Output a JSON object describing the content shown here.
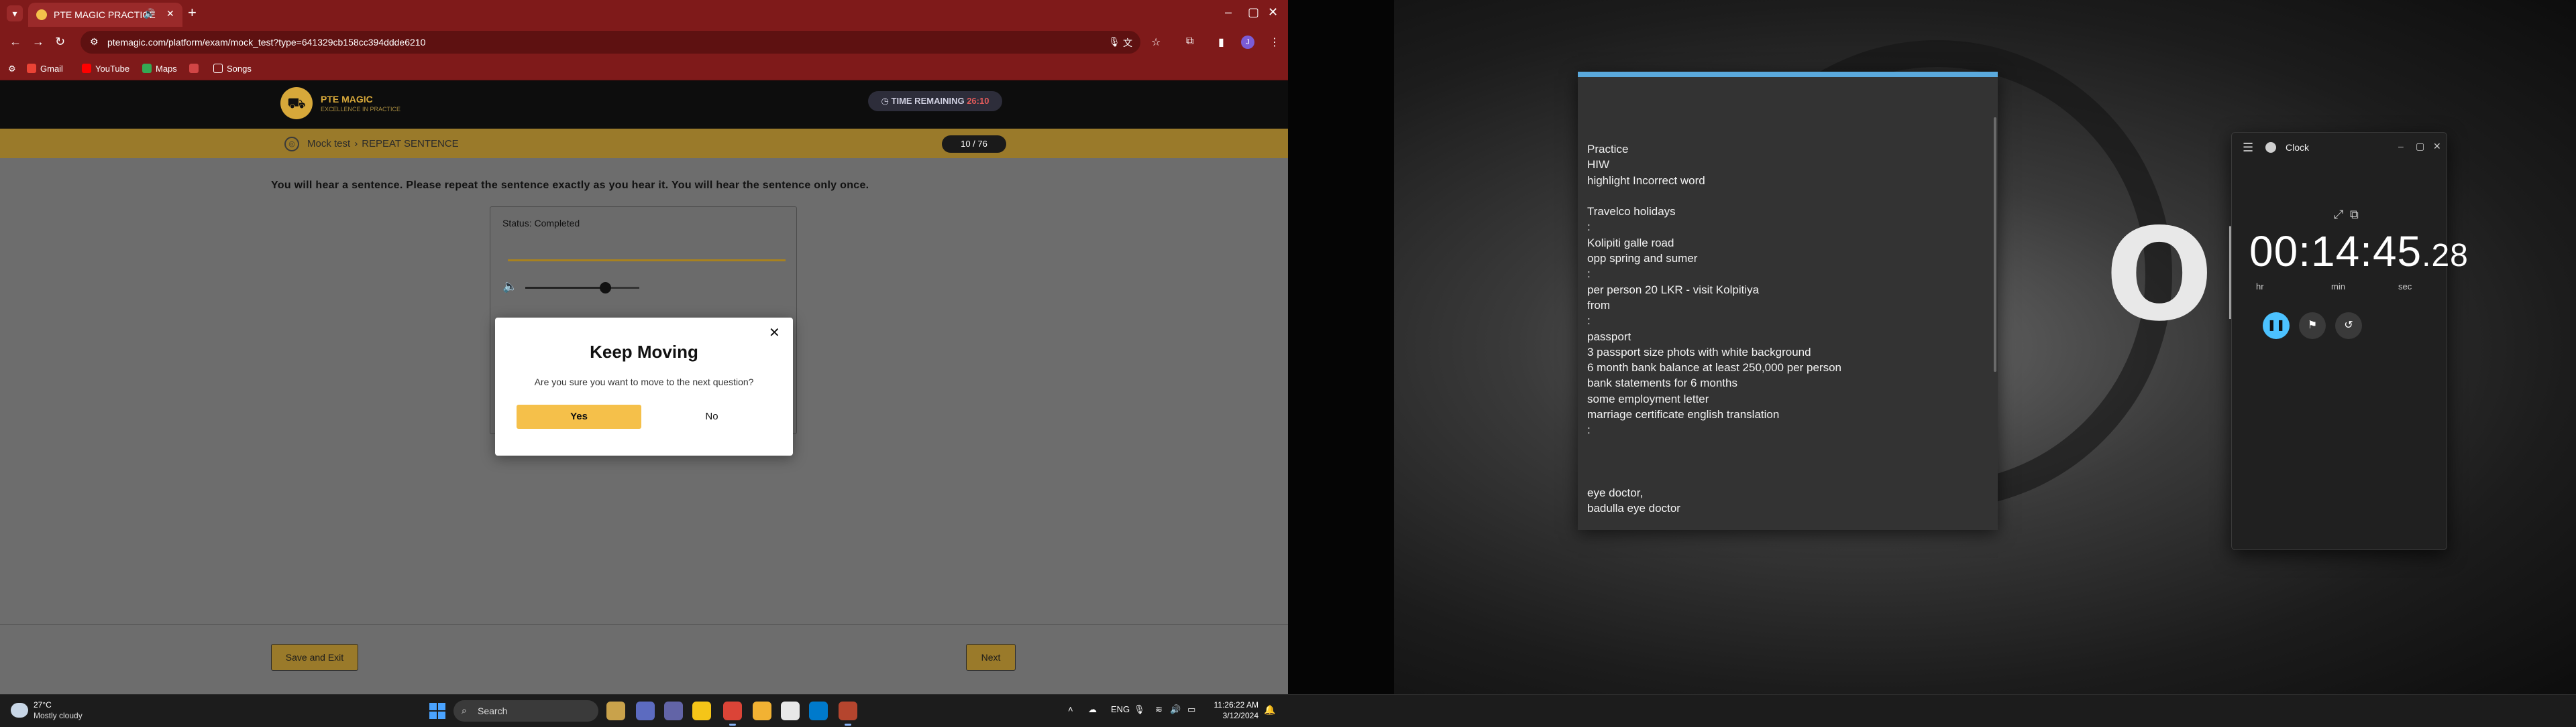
{
  "browser": {
    "tab_title": "PTE MAGIC PRACTICE",
    "url": "ptemagic.com/platform/exam/mock_test?type=641329cb158cc394ddde6210",
    "bookmarks": [
      "Gmail",
      "YouTube",
      "Maps",
      "Songs"
    ],
    "profile_initial": "J"
  },
  "site": {
    "logo_name": "PTE MAGIC",
    "logo_tagline": "EXCELLENCE IN PRACTICE",
    "timer_label": "TIME REMAINING",
    "timer_value": "26:10",
    "breadcrumb_root": "Mock test",
    "breadcrumb_current": "REPEAT SENTENCE",
    "progress": "10 / 76",
    "instruction": "You will hear a sentence. Please repeat the sentence exactly as you hear it. You will hear the sentence only once.",
    "audio": {
      "status": "Status: Completed",
      "volume_level": 0.7
    },
    "buttons": {
      "save_exit": "Save and Exit",
      "next": "Next"
    },
    "modal": {
      "title": "Keep Moving",
      "message": "Are you sure you want to move to the next question?",
      "yes": "Yes",
      "no": "No"
    }
  },
  "notes": {
    "lines": [
      "Practice",
      "HIW",
      "highlight Incorrect word",
      "",
      "Travelco holidays",
      ":",
      "Kolipiti galle road",
      "opp spring and sumer",
      ":",
      "per person 20 LKR  - visit Kolpitiya",
      "from",
      ":",
      "passport",
      "3 passport size phots with white background",
      "6 month bank balance  at least 250,000 per person",
      "bank statements  for 6 months",
      "some employment letter",
      "marriage certificate english translation",
      ":",
      "",
      "",
      "",
      "eye doctor,",
      "badulla eye doctor"
    ]
  },
  "wallpaper": {
    "text": "ORI"
  },
  "clock_app": {
    "title": "Clock",
    "time_main": "00:14:45",
    "time_centis": ".28",
    "units": [
      "hr",
      "min",
      "sec"
    ]
  },
  "taskbar": {
    "weather_temp": "27°C",
    "weather_desc": "Mostly cloudy",
    "search_placeholder": "Search",
    "language": "ENG",
    "time": "11:26:22 AM",
    "date": "3/12/2024"
  },
  "colors": {
    "chrome_frame": "#7f1a1a",
    "accent_gold": "#f5c04a",
    "clock_accent": "#4cc2ff"
  }
}
